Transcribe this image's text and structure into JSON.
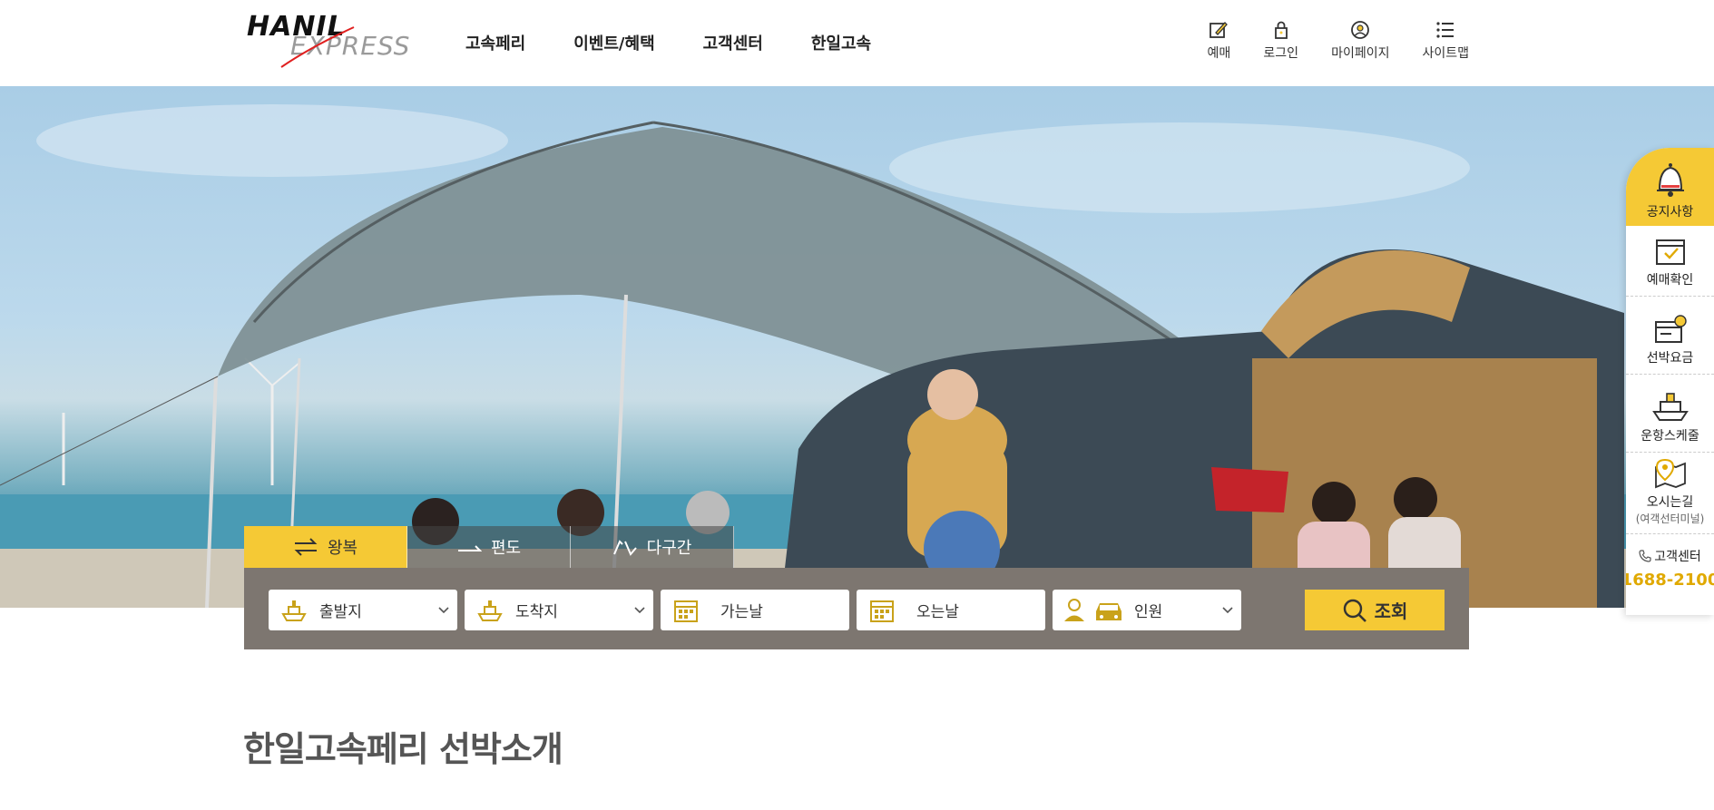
{
  "brand": {
    "logo_top": "HANIL",
    "logo_bottom": "EXPRESS"
  },
  "nav": {
    "items": [
      {
        "label": "고속페리"
      },
      {
        "label": "이벤트/혜택"
      },
      {
        "label": "고객센터"
      },
      {
        "label": "한일고속"
      }
    ]
  },
  "util": {
    "booking": "예매",
    "login": "로그인",
    "mypage": "마이페이지",
    "sitemap": "사이트맵"
  },
  "booking": {
    "tabs": [
      {
        "label": "왕복",
        "active": true
      },
      {
        "label": "편도",
        "active": false
      },
      {
        "label": "다구간",
        "active": false
      }
    ],
    "departure": "출발지",
    "arrival": "도착지",
    "go_date": "가는날",
    "return_date": "오는날",
    "passengers": "인원",
    "search": "조회"
  },
  "section": {
    "title": "한일고속페리 선박소개"
  },
  "quick_menu": {
    "notice": "공지사항",
    "reservation_check": "예매확인",
    "fare": "선박요금",
    "schedule": "운항스케줄",
    "directions": "오시는길",
    "directions_sub": "(여객선터미널)",
    "call_label": "고객센터",
    "call_number": "1688-2100"
  },
  "colors": {
    "accent": "#f5c935",
    "bar": "#7d7670",
    "phone": "#e0a900"
  }
}
